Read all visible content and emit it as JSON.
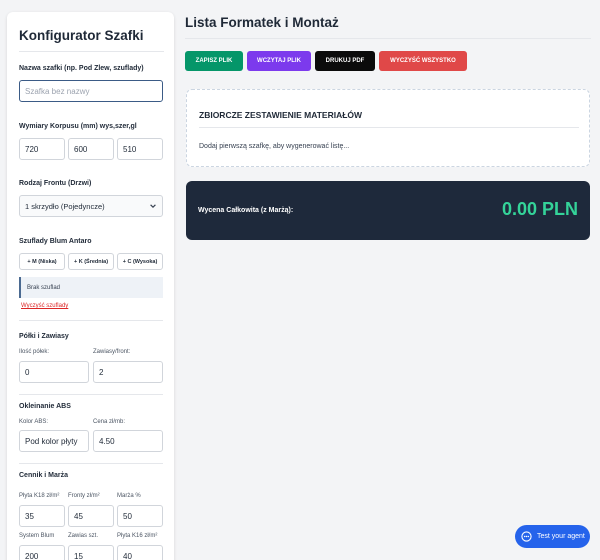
{
  "sidebar": {
    "title": "Konfigurator Szafki",
    "name_label": "Nazwa szafki (np. Pod Zlew, szuflady)",
    "name_placeholder": "Szafka bez nazwy",
    "dims_label": "Wymiary Korpusu (mm) wys,szer,gl",
    "dims": [
      "720",
      "600",
      "510"
    ],
    "front_label": "Rodzaj Frontu (Drzwi)",
    "front_selected": "1 skrzydło (Pojedyncze)",
    "drawers_label": "Szuflady Blum Antaro",
    "drawer_buttons": [
      "+ M (Niska)",
      "+ K (Średnia)",
      "+ C (Wysoka)"
    ],
    "drawers_empty": "Brak szuflad",
    "clear_drawers": "Wyczyść szuflady",
    "shelves_label": "Półki i Zawiasy",
    "shelves_count_label": "Ilość półek:",
    "shelves_count": "0",
    "hinges_label": "Zawiasy/front:",
    "hinges": "2",
    "abs_label": "Okleinanie ABS",
    "abs_color_label": "Kolor ABS:",
    "abs_color": "Pod kolor płyty",
    "abs_price_label": "Cena zł/mb:",
    "abs_price": "4.50",
    "pricing_label": "Cennik i Marża",
    "plate_k18_label": "Płyta K18 zł/m²",
    "plate_k18": "35",
    "fronts_label": "Fronty zł/m²",
    "fronts": "45",
    "margin_label": "Marża %",
    "margin": "50",
    "blum_label": "System Blum",
    "blum": "200",
    "hinges_price_label": "Zawias szt.",
    "hinges_price": "15",
    "plate_k16_label": "Płyta K16 zł/m²",
    "plate_k16": "40"
  },
  "main": {
    "title": "Lista Formatek i Montaż",
    "toolbar": [
      {
        "label": "ZAPISZ PLIK",
        "color": "#059669"
      },
      {
        "label": "WCZYTAJ PLIK",
        "color": "#7c3aed"
      },
      {
        "label": "DRUKUJ PDF",
        "color": "#0b0b0b"
      },
      {
        "label": "WYCZYŚĆ WSZYSTKO",
        "color": "#e04848"
      }
    ],
    "summary_title": "ZBIORCZE ZESTAWIENIE MATERIAŁÓW",
    "summary_text": "Dodaj pierwszą szafkę, aby wygenerować listę...",
    "price_label": "Wycena Całkowita (z Marżą):",
    "price_value": "0.00 PLN"
  },
  "agent_button": "Test your agent",
  "icons": {
    "dropdown": "chevron-down-icon",
    "agent": "chat-icon"
  }
}
